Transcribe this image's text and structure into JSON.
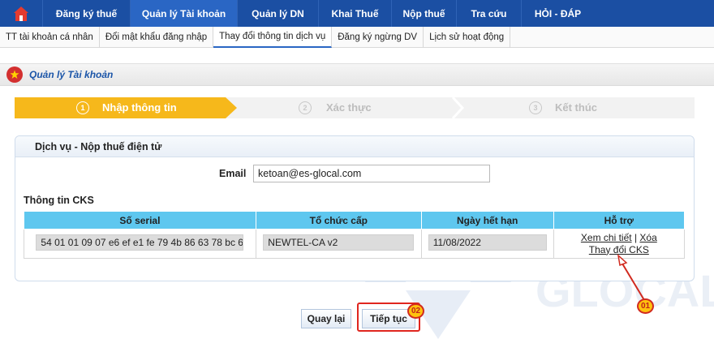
{
  "nav": {
    "items": [
      {
        "label": "Đăng ký thuế",
        "width": 108,
        "active": false
      },
      {
        "label": "Quản lý Tài khoản",
        "width": 132,
        "active": true
      },
      {
        "label": "Quản lý DN",
        "width": 100,
        "active": false
      },
      {
        "label": "Khai Thuế",
        "width": 90,
        "active": false
      },
      {
        "label": "Nộp thuế",
        "width": 80,
        "active": false
      },
      {
        "label": "Tra cứu",
        "width": 80,
        "active": false
      },
      {
        "label": "HỎI - ĐÁP",
        "width": 90,
        "active": false
      }
    ]
  },
  "subnav": {
    "items": [
      {
        "label": "TT tài khoản cá nhân",
        "active": false
      },
      {
        "label": "Đổi mật khẩu đăng nhập",
        "active": false
      },
      {
        "label": "Thay đổi thông tin dịch vụ",
        "active": true
      },
      {
        "label": "Đăng ký ngừng DV",
        "active": false
      },
      {
        "label": "Lịch sử hoạt động",
        "active": false
      }
    ]
  },
  "module": {
    "title": "Quản lý Tài khoản"
  },
  "steps": [
    {
      "num": "1",
      "label": "Nhập thông tin"
    },
    {
      "num": "2",
      "label": "Xác thực"
    },
    {
      "num": "3",
      "label": "Kết thúc"
    }
  ],
  "panel": {
    "title": "Dịch vụ - Nộp thuế điện tử"
  },
  "email": {
    "label": "Email",
    "value": "ketoan@es-glocal.com"
  },
  "cks": {
    "label": "Thông tin CKS",
    "headers": [
      "Số serial",
      "Tổ chức cấp",
      "Ngày hết hạn",
      "Hỗ trợ"
    ],
    "row": {
      "serial": "54 01 01 09 07 e6 ef e1 fe 79 4b 86 63 78 bc 6",
      "issuer": "NEWTEL-CA v2",
      "expiry": "11/08/2022",
      "detail_link": "Xem chi tiết",
      "separator": "|",
      "delete_link": "Xóa",
      "change_link": "Thay đổi CKS"
    }
  },
  "buttons": {
    "back": "Quay lại",
    "next": "Tiếp tục"
  },
  "annotations": {
    "badge1": "01",
    "badge2": "02"
  },
  "colors": {
    "nav": "#1b4fa3",
    "step_active": "#f6b81b",
    "table_header": "#5ec7ef",
    "highlight": "#e0261f"
  }
}
